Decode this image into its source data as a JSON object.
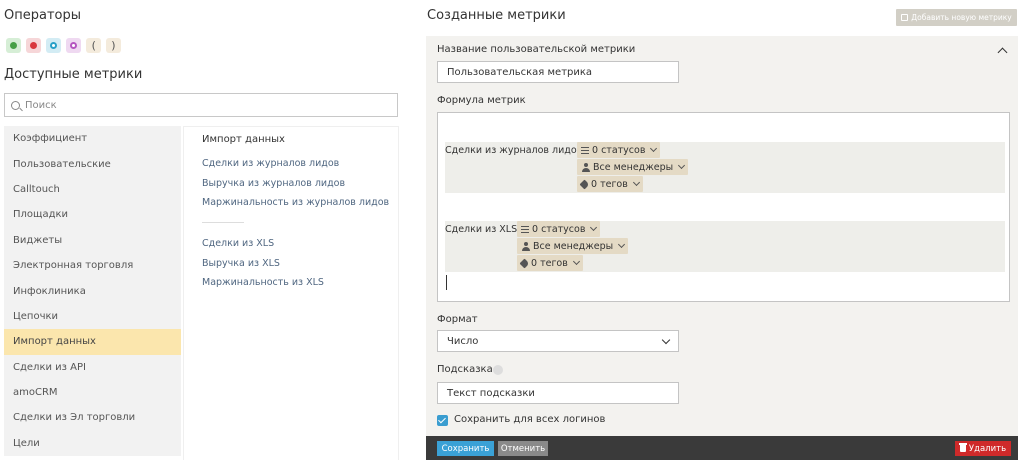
{
  "left": {
    "operators_title": "Операторы",
    "operators": [
      {
        "name": "plus",
        "label": ""
      },
      {
        "name": "minus",
        "label": ""
      },
      {
        "name": "multiply",
        "label": ""
      },
      {
        "name": "divide",
        "label": ""
      },
      {
        "name": "paren-open",
        "label": "("
      },
      {
        "name": "paren-close",
        "label": ")"
      }
    ],
    "metrics_title": "Доступные метрики",
    "search_placeholder": "Поиск",
    "categories": [
      "Коэффициент",
      "Пользовательские",
      "Calltouch",
      "Площадки",
      "Виджеты",
      "Электронная торговля",
      "Инфоклиника",
      "Цепочки",
      "Импорт данных",
      "Сделки из API",
      "amoCRM",
      "Сделки из Эл торговли",
      "Цели"
    ],
    "active_category": "Импорт данных",
    "submenu": {
      "heading": "Импорт данных",
      "group1": [
        "Сделки из журналов лидов",
        "Выручка из журналов лидов",
        "Маржинальность из журналов лидов"
      ],
      "group2": [
        "Сделки из XLS",
        "Выручка из XLS",
        "Маржинальность из XLS"
      ]
    }
  },
  "right": {
    "title": "Созданные метрики",
    "add_button": "Добавить новую метрику",
    "name_label": "Название пользовательской метрики",
    "name_value": "Пользовательская метрика",
    "formula_label": "Формула метрик",
    "formula_terms": [
      {
        "name": "Сделки из журналов лидов",
        "statuses": "0 статусов",
        "managers": "Все менеджеры",
        "tags": "0 тегов"
      },
      {
        "name": "Сделки из XLS",
        "statuses": "0 статусов",
        "managers": "Все менеджеры",
        "tags": "0 тегов"
      }
    ],
    "format_label": "Формат",
    "format_value": "Число",
    "hint_label": "Подсказка",
    "hint_value": "Текст подсказки",
    "save_all_label": "Сохранить для всех логинов",
    "save_all_checked": true,
    "save_button": "Сохранить",
    "cancel_button": "Отменить",
    "delete_button": "Удалить"
  },
  "colors": {
    "active_category": "#fbe6ad",
    "chip": "#e4dac5",
    "save": "#3aa1d6",
    "delete": "#cf2a2a",
    "footer": "#3a3a3a"
  }
}
